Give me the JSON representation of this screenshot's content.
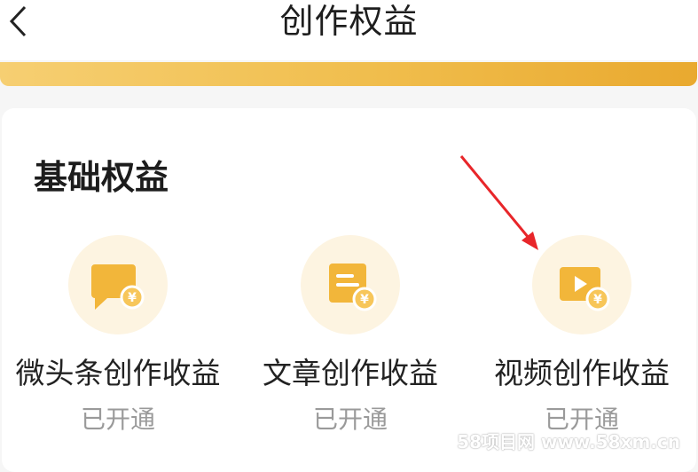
{
  "header": {
    "title": "创作权益",
    "back_icon": "chevron-left-icon"
  },
  "section": {
    "title": "基础权益"
  },
  "items": [
    {
      "label": "微头条创作收益",
      "status": "已开通",
      "icon": "chat-bubble-coin-icon"
    },
    {
      "label": "文章创作收益",
      "status": "已开通",
      "icon": "document-coin-icon"
    },
    {
      "label": "视频创作收益",
      "status": "已开通",
      "icon": "video-coin-icon"
    }
  ],
  "watermark": {
    "text": "58项目网 www.58xm.cn"
  },
  "colors": {
    "gold": "#f0bd4c",
    "icon_gold": "#f2b63a",
    "arrow": "#e8262a",
    "status_gray": "#9a9a9a"
  }
}
